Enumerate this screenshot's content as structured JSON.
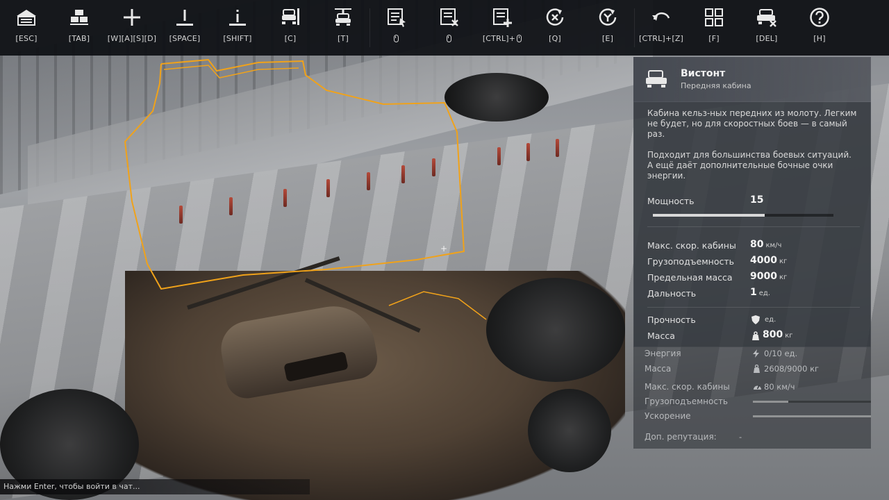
{
  "toolbar": {
    "tools": [
      {
        "icon": "garage-exit-icon",
        "key": "[ESC]"
      },
      {
        "icon": "inventory-icon",
        "key": "[TAB]"
      },
      {
        "icon": "move-icon",
        "key": "[W][A][S][D]"
      },
      {
        "icon": "raise-icon",
        "key": "[SPACE]"
      },
      {
        "icon": "lower-icon",
        "key": "[SHIFT]"
      },
      {
        "icon": "car-lift-icon",
        "key": "[C]"
      },
      {
        "icon": "car-hoist-icon",
        "key": "[T]"
      },
      {
        "icon": "select-part-icon",
        "key": ""
      },
      {
        "icon": "remove-part-icon",
        "key": ""
      },
      {
        "icon": "add-part-icon",
        "key": "[CTRL]+"
      },
      {
        "icon": "rotate-left-icon",
        "key": "[Q]"
      },
      {
        "icon": "rotate-right-icon",
        "key": "[E]"
      },
      {
        "icon": "undo-icon",
        "key": "[CTRL]+[Z]"
      },
      {
        "icon": "grid-icon",
        "key": "[F]"
      },
      {
        "icon": "delete-vehicle-icon",
        "key": "[DEL]"
      },
      {
        "icon": "help-icon",
        "key": "[H]"
      }
    ]
  },
  "part": {
    "name": "Вистонт",
    "type": "Передняя кабина",
    "desc1": "Кабина кельз-ных передних из молоту. Легким не будет, но для скоростных боев — в самый раз.",
    "desc2": "Подходит для большинства боевых ситуаций. А ещё даёт дополнительные бочные очки энергии.",
    "power_label": "Мощность",
    "power_value": "15",
    "power_fraction": 0.62,
    "stats": [
      {
        "label": "Макс. скор. кабины",
        "value": "80",
        "unit": "км/ч"
      },
      {
        "label": "Грузоподъемность",
        "value": "4000",
        "unit": "кг"
      },
      {
        "label": "Предельная масса",
        "value": "9000",
        "unit": "кг"
      },
      {
        "label": "Дальность",
        "value": "1",
        "unit": "ед."
      }
    ],
    "durability_label": "Прочность",
    "durability_value": "",
    "durability_unit": "ед.",
    "mass_label": "Масса",
    "mass_value": "800",
    "mass_unit": "кг"
  },
  "build": {
    "energy_label": "Энергия",
    "energy_value": "0/10 ед.",
    "mass_label": "Масса",
    "mass_value": "2608/9000 кг",
    "speed_label": "Макс. скор. кабины",
    "speed_value": "80 км/ч",
    "capacity_label": "Грузоподъемность",
    "capacity_fraction": 0.3,
    "accel_label": "Ускорение",
    "accel_fraction": 1.0,
    "rep_label": "Доп. репутация:",
    "rep_value": "-"
  },
  "chat": {
    "hint": "Нажми Enter, чтобы войти в чат..."
  },
  "colors": {
    "selection_outline": "#f0a21a",
    "toolbar_bg": "#0e1014"
  }
}
